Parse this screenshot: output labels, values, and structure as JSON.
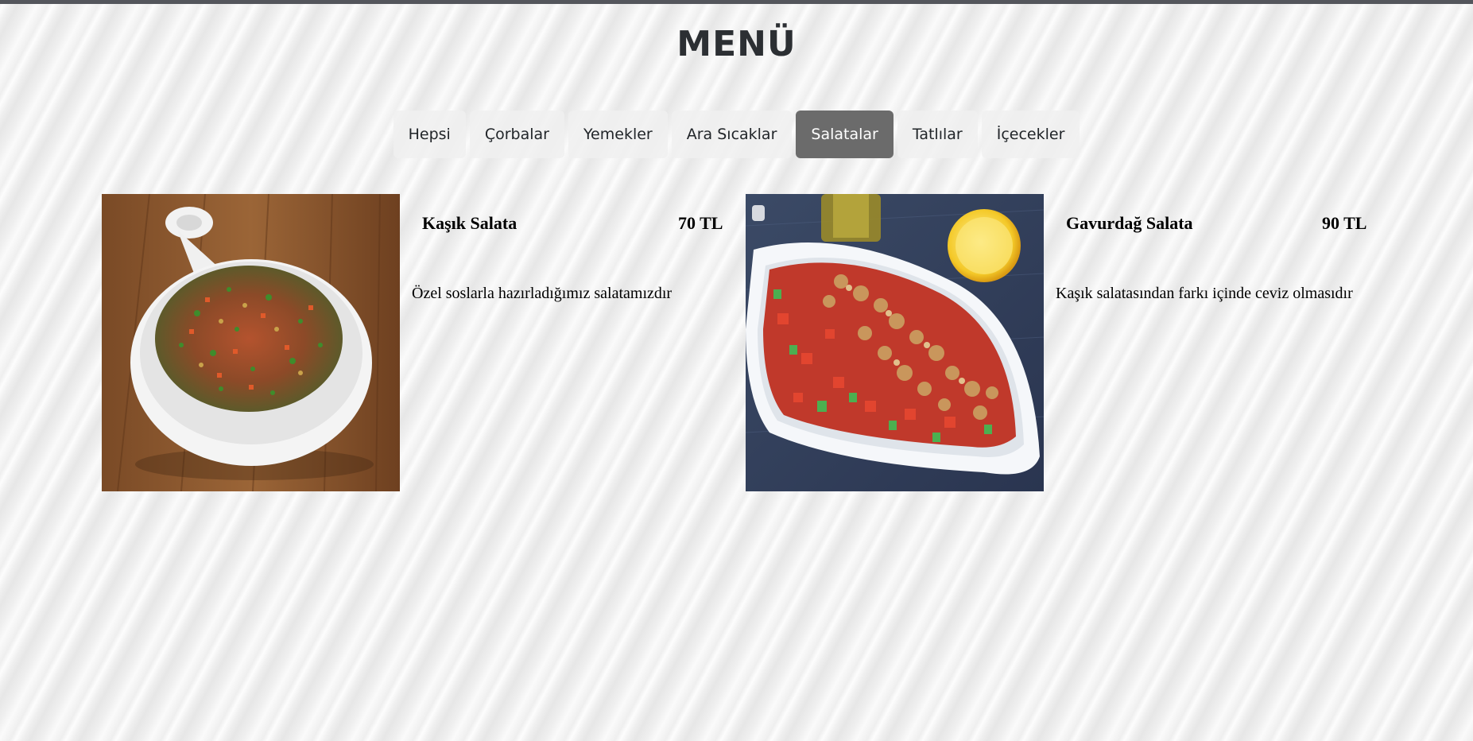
{
  "title": "MENÜ",
  "tabs": [
    {
      "label": "Hepsi",
      "active": false
    },
    {
      "label": "Çorbalar",
      "active": false
    },
    {
      "label": "Yemekler",
      "active": false
    },
    {
      "label": "Ara Sıcaklar",
      "active": false
    },
    {
      "label": "Salatalar",
      "active": true
    },
    {
      "label": "Tatlılar",
      "active": false
    },
    {
      "label": "İçecekler",
      "active": false
    }
  ],
  "items": [
    {
      "name": "Kaşık Salata",
      "price": "70 TL",
      "description": "Özel soslarla hazırladığımız salatamızdır"
    },
    {
      "name": "Gavurdağ Salata",
      "price": "90 TL",
      "description": "Kaşık salatasından farkı içinde ceviz olmasıdır"
    }
  ],
  "colors": {
    "active_tab_bg": "#6b6b6b",
    "active_tab_text": "#ffffff",
    "title": "#2c2f33",
    "top_border": "#54565c"
  }
}
